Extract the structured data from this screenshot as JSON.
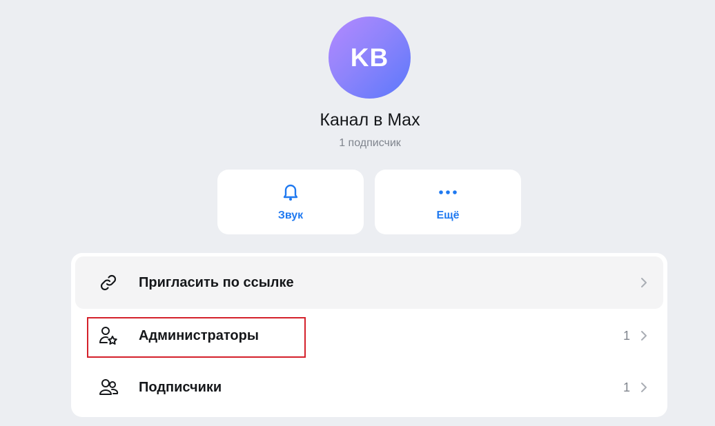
{
  "channel": {
    "avatar_initials": "KB",
    "name": "Канал в Max",
    "subscribers": "1 подписчик"
  },
  "actions": {
    "sound_label": "Звук",
    "more_label": "Ещё"
  },
  "menu": {
    "invite_label": "Пригласить по ссылке",
    "admins_label": "Администраторы",
    "admins_count": "1",
    "subscribers_label": "Подписчики",
    "subscribers_count": "1"
  },
  "colors": {
    "accent": "#1f79f0",
    "highlight": "#d4202a",
    "background": "#eceef2"
  },
  "icons": {
    "sound": "bell-icon",
    "more": "more-dots-icon",
    "invite": "link-icon",
    "admins": "admin-star-user-icon",
    "subscribers": "users-icon",
    "chevron": "chevron-right-icon"
  }
}
